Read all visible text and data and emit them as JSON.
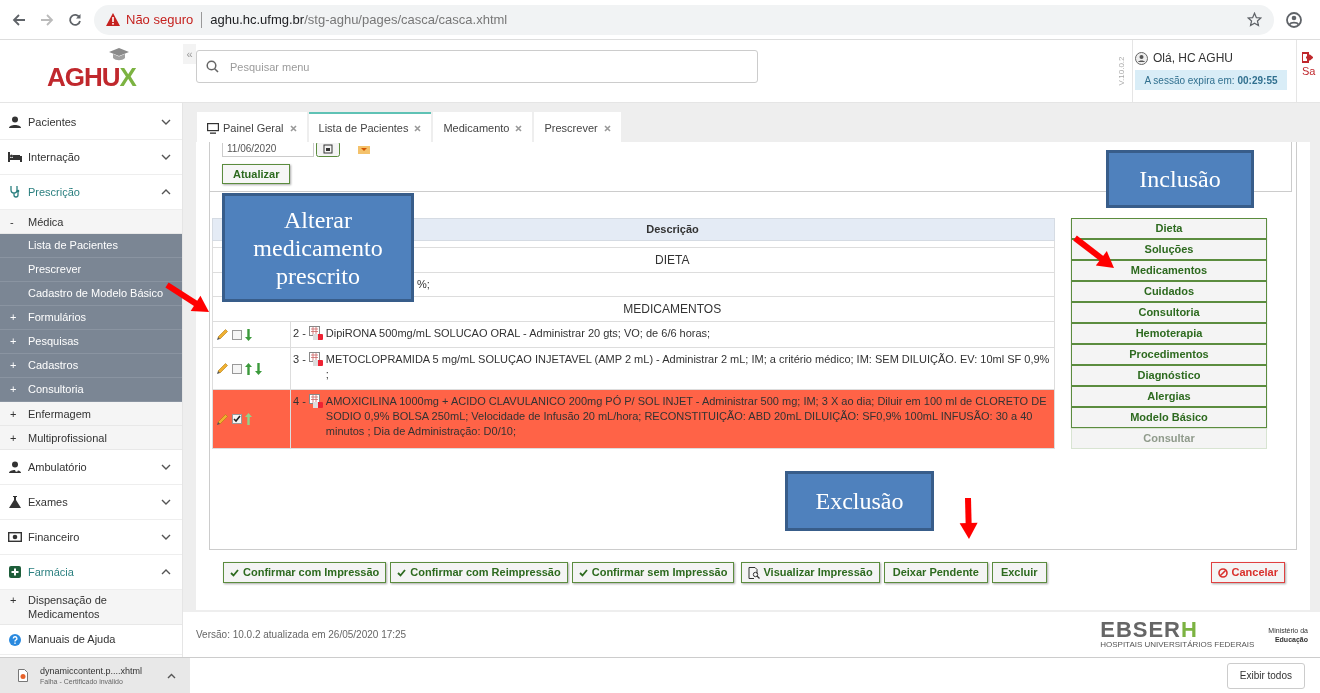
{
  "browser": {
    "security": "Não seguro",
    "url_host": "aghu.hc.ufmg.br",
    "url_path": "/stg-aghu/pages/casca/casca.xhtml"
  },
  "header": {
    "logo": "AGHU",
    "logo_accent": "X",
    "collapse": "«",
    "search": {
      "placeholder": "Pesquisar menu"
    },
    "version": "V.10.0.2",
    "greeting": "Olá, HC AGHU",
    "session_label": "A sessão expira em:",
    "session_time": "00:29:55",
    "logout": "Sa"
  },
  "sidebar": {
    "items": [
      {
        "label": "Pacientes",
        "expanded": false
      },
      {
        "label": "Internação",
        "expanded": false
      },
      {
        "label": "Prescrição",
        "expanded": true,
        "children": [
          {
            "label": "Médica",
            "marker": "-",
            "children": [
              {
                "label": "Lista de Pacientes"
              },
              {
                "label": "Prescrever"
              },
              {
                "label": "Cadastro de Modelo Básico"
              },
              {
                "label": "Formulários",
                "marker": "+"
              },
              {
                "label": "Pesquisas",
                "marker": "+"
              },
              {
                "label": "Cadastros",
                "marker": "+"
              },
              {
                "label": "Consultoria",
                "marker": "+"
              }
            ]
          },
          {
            "label": "Enfermagem",
            "marker": "+"
          },
          {
            "label": "Multiprofissional",
            "marker": "+"
          }
        ]
      },
      {
        "label": "Ambulatório",
        "expanded": false
      },
      {
        "label": "Exames",
        "expanded": false
      },
      {
        "label": "Financeiro",
        "expanded": false
      },
      {
        "label": "Farmácia",
        "expanded": true,
        "children": [
          {
            "label": "Dispensação de Medicamentos",
            "marker": "+"
          }
        ]
      },
      {
        "label": "Manuais de Ajuda"
      }
    ]
  },
  "tabs": [
    {
      "label": "Painel Geral",
      "selected": false
    },
    {
      "label": "Lista de Pacientes",
      "selected": true
    },
    {
      "label": "Medicamento",
      "selected": false
    },
    {
      "label": "Prescrever",
      "selected": false
    }
  ],
  "filter": {
    "date": "11/06/2020",
    "refresh": "Atualizar"
  },
  "table": {
    "columns": [
      "Descrição"
    ],
    "rows": [
      {
        "kind": "group",
        "label": "DIETA"
      },
      {
        "kind": "partial",
        "description": "%;"
      },
      {
        "kind": "group",
        "label": "MEDICAMENTOS"
      },
      {
        "kind": "item",
        "number": "2 -",
        "description": "DipiRONA 500mg/mL SOLUCAO ORAL - Administrar 20 gts; VO; de 6/6 horas;",
        "checked": false,
        "highlighted": false,
        "move_up": false,
        "move_down": true
      },
      {
        "kind": "item",
        "number": "3 -",
        "description": "METOCLOPRAMIDA 5 mg/mL SOLUÇAO INJETAVEL (AMP 2 mL) - Administrar 2 mL; IM; a critério médico; IM: SEM DILUIÇÃO. EV: 10ml SF 0,9% ;",
        "checked": false,
        "highlighted": false,
        "move_up": true,
        "move_down": true
      },
      {
        "kind": "item",
        "number": "4 -",
        "description": "AMOXICILINA 1000mg + ACIDO CLAVULANICO 200mg PÓ P/ SOL INJET - Administrar 500 mg; IM; 3 X ao dia; Diluir em 100 ml de CLORETO DE SODIO 0,9% BOLSA 250mL; Velocidade de Infusão 20 mL/hora; RECONSTITUIÇÃO: ABD 20mL DILUIÇÃO: SF0,9% 100mL INFUSÃO: 30 a 40 minutos ; Dia de Administração: D0/10;",
        "checked": true,
        "highlighted": true,
        "move_up": true,
        "move_down": false
      }
    ]
  },
  "add_buttons": [
    {
      "label": "Dieta",
      "disabled": false
    },
    {
      "label": "Soluções",
      "disabled": false
    },
    {
      "label": "Medicamentos",
      "disabled": false
    },
    {
      "label": "Cuidados",
      "disabled": false
    },
    {
      "label": "Consultoria",
      "disabled": false
    },
    {
      "label": "Hemoterapia",
      "disabled": false
    },
    {
      "label": "Procedimentos",
      "disabled": false
    },
    {
      "label": "Diagnóstico",
      "disabled": false
    },
    {
      "label": "Alergias",
      "disabled": false
    },
    {
      "label": "Modelo Básico",
      "disabled": false
    },
    {
      "label": "Consultar",
      "disabled": true
    }
  ],
  "actions": [
    {
      "label": "Confirmar com Impressão",
      "kind": "confirm"
    },
    {
      "label": "Confirmar com Reimpressão",
      "kind": "confirm"
    },
    {
      "label": "Confirmar sem Impressão",
      "kind": "confirm"
    },
    {
      "label": "Visualizar Impressão",
      "kind": "preview"
    },
    {
      "label": "Deixar Pendente",
      "kind": "plain"
    },
    {
      "label": "Excluir",
      "kind": "plain"
    },
    {
      "label": "Cancelar",
      "kind": "cancel"
    }
  ],
  "footer": {
    "version": "Versão: 10.0.2 atualizada em 26/05/2020 17:25",
    "brand": "EBSER",
    "brand_accent": "H",
    "brand_subtitle": "HOSPITAIS UNIVERSITÁRIOS FEDERAIS",
    "ministry": "Ministério da",
    "ministry_bold": "Educação"
  },
  "annotations": [
    {
      "text": "Alterar medicamento prescrito"
    },
    {
      "text": "Inclusão"
    },
    {
      "text": "Exclusão"
    }
  ],
  "downloads": {
    "file": "dynamiccontent.p....xhtml",
    "status": "Falha - Certificado inválido",
    "show_all": "Exibir todos"
  }
}
